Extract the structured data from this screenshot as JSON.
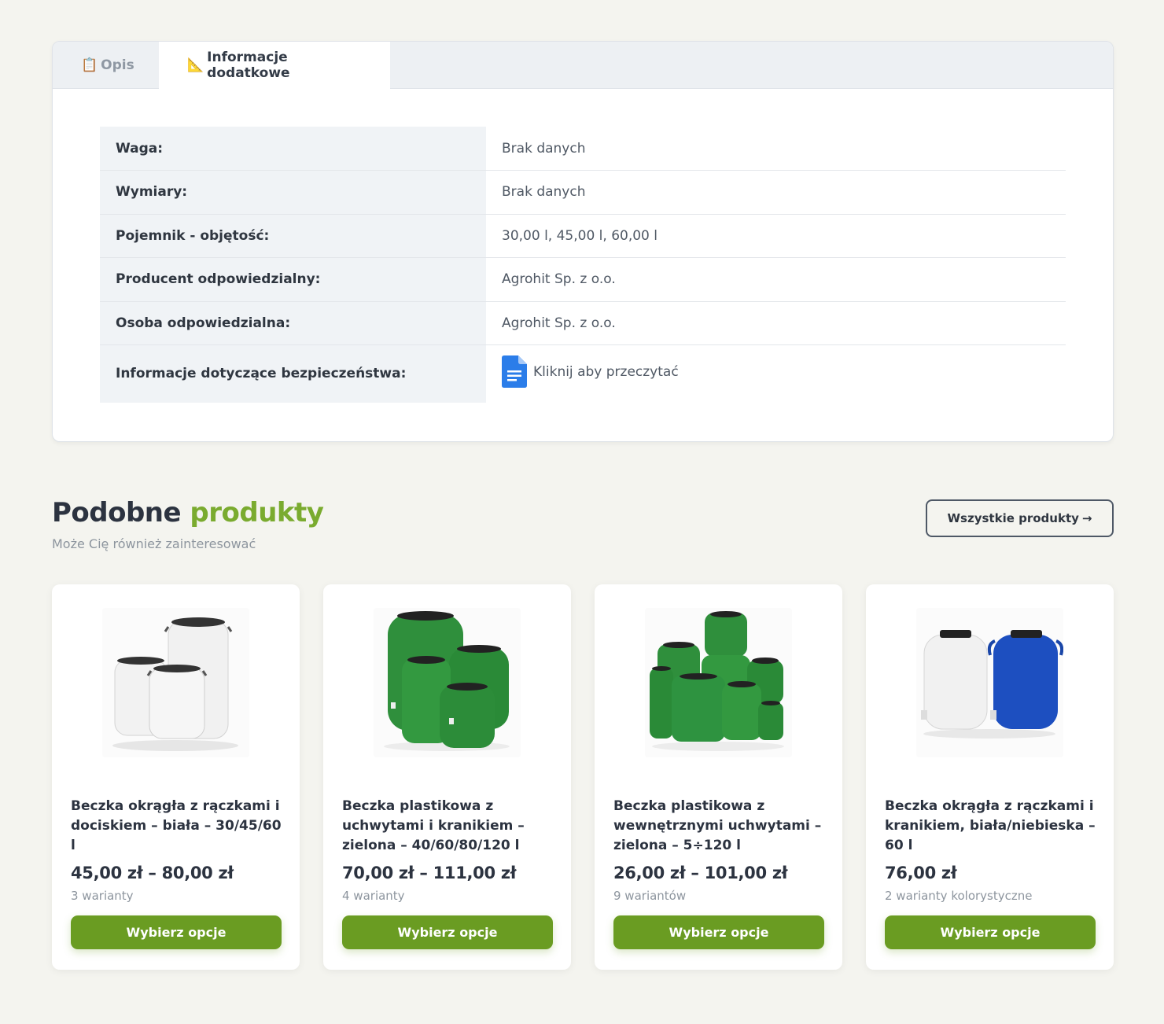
{
  "tabs": [
    {
      "icon": "📋",
      "label": "Opis"
    },
    {
      "icon": "📐",
      "label": "Informacje dodatkowe"
    }
  ],
  "attributes": [
    {
      "key": "Waga:",
      "value": "Brak danych"
    },
    {
      "key": "Wymiary:",
      "value": "Brak danych"
    },
    {
      "key": "Pojemnik - objętość:",
      "value": "30,00 l, 45,00 l, 60,00 l"
    },
    {
      "key": "Producent odpowiedzialny:",
      "value": "Agrohit Sp. z o.o."
    },
    {
      "key": "Osoba odpowiedzialna:",
      "value": "Agrohit Sp. z o.o."
    },
    {
      "key": "Informacje dotyczące bezpieczeństwa:",
      "value": "Kliknij aby przeczytać",
      "icon": "google-doc-icon"
    }
  ],
  "similar": {
    "title_part1": "Podobne",
    "title_part2": "produkty",
    "subtitle": "Może Cię również zainteresować",
    "all_button": "Wszystkie produkty",
    "all_button_arrow": "→",
    "accent_color": "#7aab2f",
    "button_color": "#6a9c22"
  },
  "products": [
    {
      "title": "Beczka okrągła z rączkami i dociskiem – biała – 30/45/60 l",
      "price": "45,00 zł – 80,00 zł",
      "variants": "3 warianty",
      "button": "Wybierz opcje",
      "image": "white-barrels"
    },
    {
      "title": "Beczka plastikowa z uchwytami i kranikiem – zielona – 40/60/80/120 l",
      "price": "70,00 zł – 111,00 zł",
      "variants": "4 warianty",
      "button": "Wybierz opcje",
      "image": "green-barrels-tap"
    },
    {
      "title": "Beczka plastikowa z wewnętrznymi uchwytami – zielona – 5÷120 l",
      "price": "26,00 zł – 101,00 zł",
      "variants": "9 wariantów",
      "button": "Wybierz opcje",
      "image": "green-barrels-group"
    },
    {
      "title": "Beczka okrągła z rączkami i kranikiem, biała/niebieska – 60 l",
      "price": "76,00 zł",
      "variants": "2 warianty kolorystyczne",
      "button": "Wybierz opcje",
      "image": "white-blue-barrels"
    }
  ]
}
